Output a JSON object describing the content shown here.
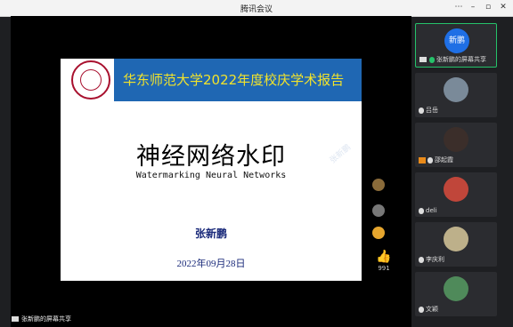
{
  "window": {
    "title": "腾讯会议",
    "controls": [
      "⋯",
      "–",
      "▫",
      "✕"
    ]
  },
  "slide": {
    "banner_title": "华东师范大学2022年度校庆学术报告",
    "title": "神经网络水印",
    "subtitle": "Watermarking Neural Networks",
    "author": "张新鹏",
    "date": "2022年09月28日",
    "watermark": "张新鹏"
  },
  "reactions": {
    "like_count": "991"
  },
  "share_label": "张新鹏的屏幕共享",
  "participants": [
    {
      "avatar_text": "新鹏",
      "label": "张新鹏的屏幕共享"
    },
    {
      "avatar_text": "",
      "label": "吕岳"
    },
    {
      "avatar_text": "",
      "label": "邵起霞"
    },
    {
      "avatar_text": "",
      "label": "deli"
    },
    {
      "avatar_text": "",
      "label": "李庆利"
    },
    {
      "avatar_text": "",
      "label": "文颖"
    }
  ]
}
